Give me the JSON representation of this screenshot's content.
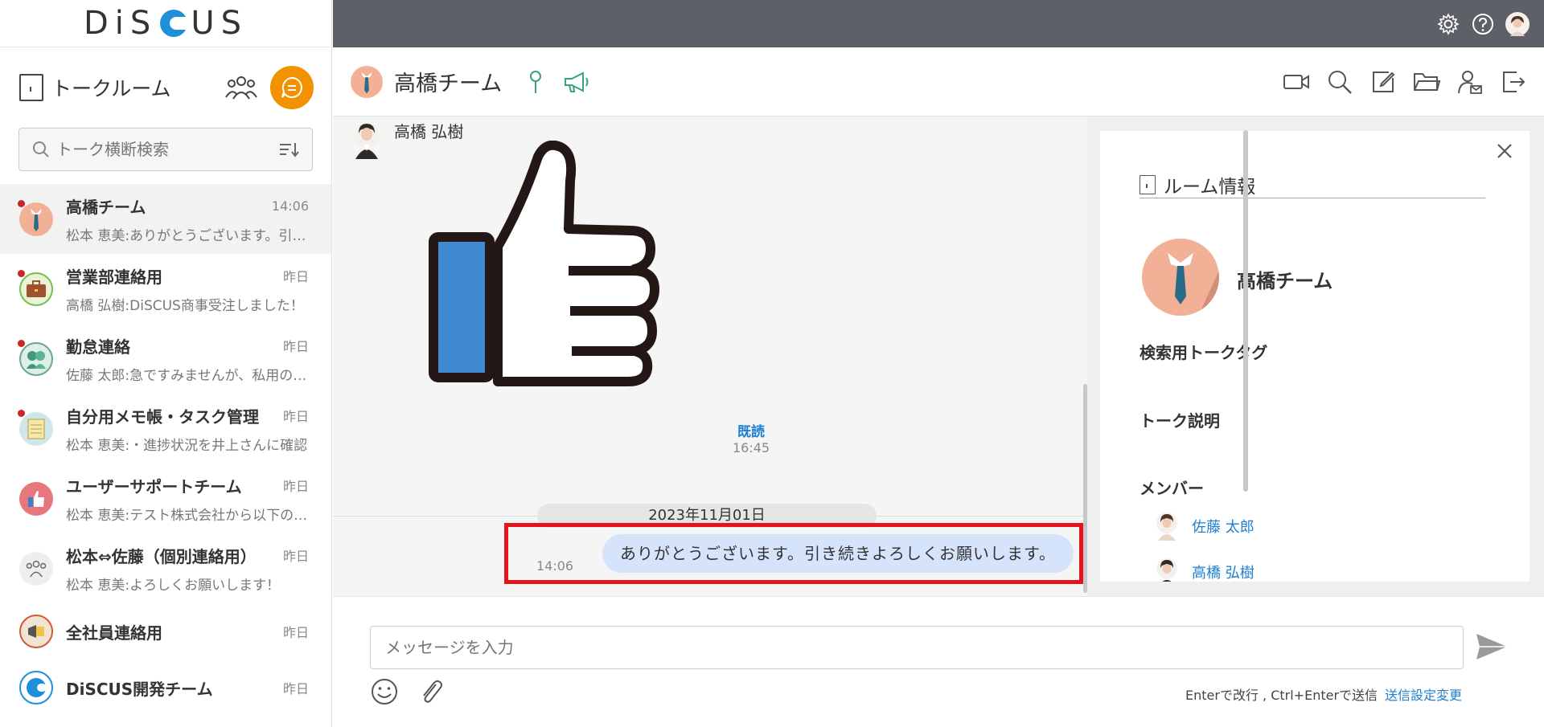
{
  "app": {
    "logo_text": "DiSCUS"
  },
  "sidebar": {
    "title": "トークルーム",
    "search_placeholder": "トーク横断検索",
    "rooms": [
      {
        "name": "高橋チーム",
        "time": "14:06",
        "last": "松本 恵美:ありがとうございます。引き続きよろしくお願いします。",
        "unread": true,
        "active": true
      },
      {
        "name": "営業部連絡用",
        "time": "昨日",
        "last": "高橋 弘樹:DiSCUS商事受注しました！",
        "unread": true,
        "active": false
      },
      {
        "name": "勤怠連絡",
        "time": "昨日",
        "last": "佐藤 太郎:急ですみませんが、私用のため",
        "unread": true,
        "active": false
      },
      {
        "name": "自分用メモ帳・タスク管理",
        "time": "昨日",
        "last": "松本 恵美:・進捗状況を井上さんに確認",
        "unread": true,
        "active": false
      },
      {
        "name": "ユーザーサポートチーム",
        "time": "昨日",
        "last": "松本 恵美:テスト株式会社から以下の問い合わせ",
        "unread": false,
        "active": false
      },
      {
        "name": "松本⇔佐藤（個別連絡用）",
        "time": "昨日",
        "last": "松本 恵美:よろしくお願いします！",
        "unread": false,
        "active": false
      },
      {
        "name": "全社員連絡用",
        "time": "昨日",
        "last": "",
        "unread": false,
        "active": false
      },
      {
        "name": "DiSCUS開発チーム",
        "time": "昨日",
        "last": "",
        "unread": false,
        "active": false
      }
    ]
  },
  "header": {
    "room_title": "高橋チーム"
  },
  "chat": {
    "sender": "高橋 弘樹",
    "read_label": "既読",
    "read_time": "16:45",
    "date": "2023年11月01日",
    "message_time": "14:06",
    "message_text": "ありがとうございます。引き続きよろしくお願いします。"
  },
  "info": {
    "title": "ルーム情報",
    "room_name": "高橋チーム",
    "tag_label": "検索用トークタグ",
    "desc_label": "トーク説明",
    "members_label": "メンバー",
    "members": [
      "佐藤 太郎",
      "高橋 弘樹"
    ]
  },
  "composer": {
    "placeholder": "メッセージを入力",
    "hint": "Enterで改行 , Ctrl+Enterで送信",
    "settings_link": "送信設定変更"
  },
  "colors": {
    "accent_orange": "#f39200",
    "topbar": "#5e6068",
    "link_blue": "#1f7fd1",
    "highlight_red": "#e4141c",
    "bubble": "#d6e4fb"
  }
}
